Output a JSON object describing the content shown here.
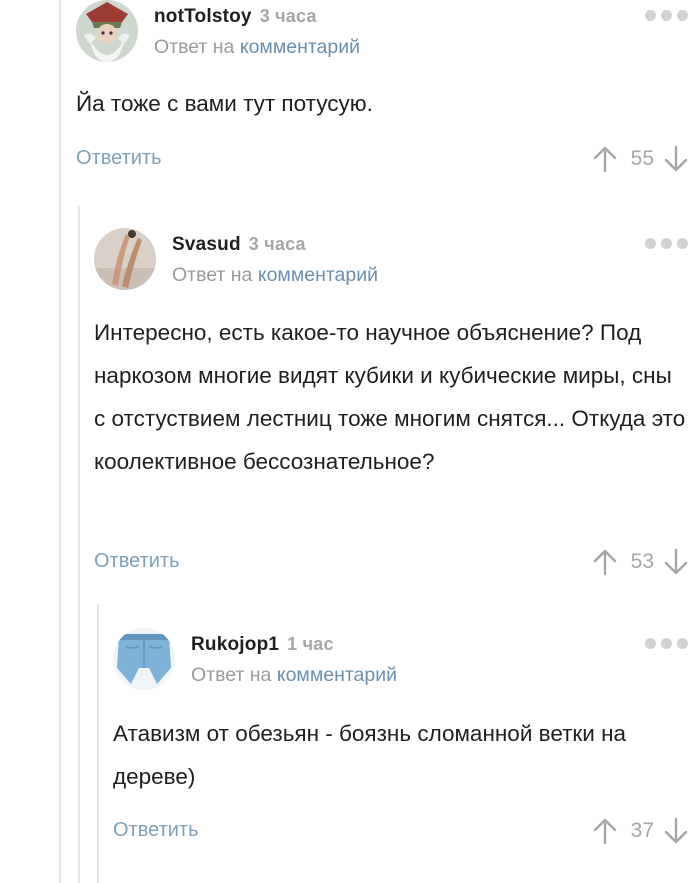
{
  "comments": [
    {
      "nick": "notTolstoy",
      "time": "3 часа",
      "reply_prefix": "Ответ на",
      "reply_link": "комментарий",
      "text": "Йа тоже с вами тут потусую.",
      "reply_label": "Ответить",
      "rating": "55",
      "avatar_icon": "wizard-avatar"
    },
    {
      "nick": "Svasud",
      "time": "3 часа",
      "reply_prefix": "Ответ на",
      "reply_link": "комментарий",
      "text": "Интересно, есть какое-то научное объяснение? Под наркозом многие видят кубики и кубические миры, сны с отстуствием лестниц тоже многим снятся... Откуда это коолективное бессознательное?",
      "reply_label": "Ответить",
      "rating": "53",
      "avatar_icon": "legs-photo-avatar"
    },
    {
      "nick": "Rukojop1",
      "time": "1 час",
      "reply_prefix": "Ответ на",
      "reply_link": "комментарий",
      "text": "Атавизм от обезьян - боязнь сломанной ветки на дереве)",
      "reply_label": "Ответить",
      "rating": "37",
      "avatar_icon": "jeans-avatar"
    }
  ],
  "colors": {
    "link": "#6a8fae",
    "reply_button": "#7f9fb8",
    "muted": "#a6a6a6",
    "thread_line": "#e6e6e6"
  },
  "icons": [
    "more-dots-icon",
    "arrow-up-icon",
    "arrow-down-icon"
  ]
}
